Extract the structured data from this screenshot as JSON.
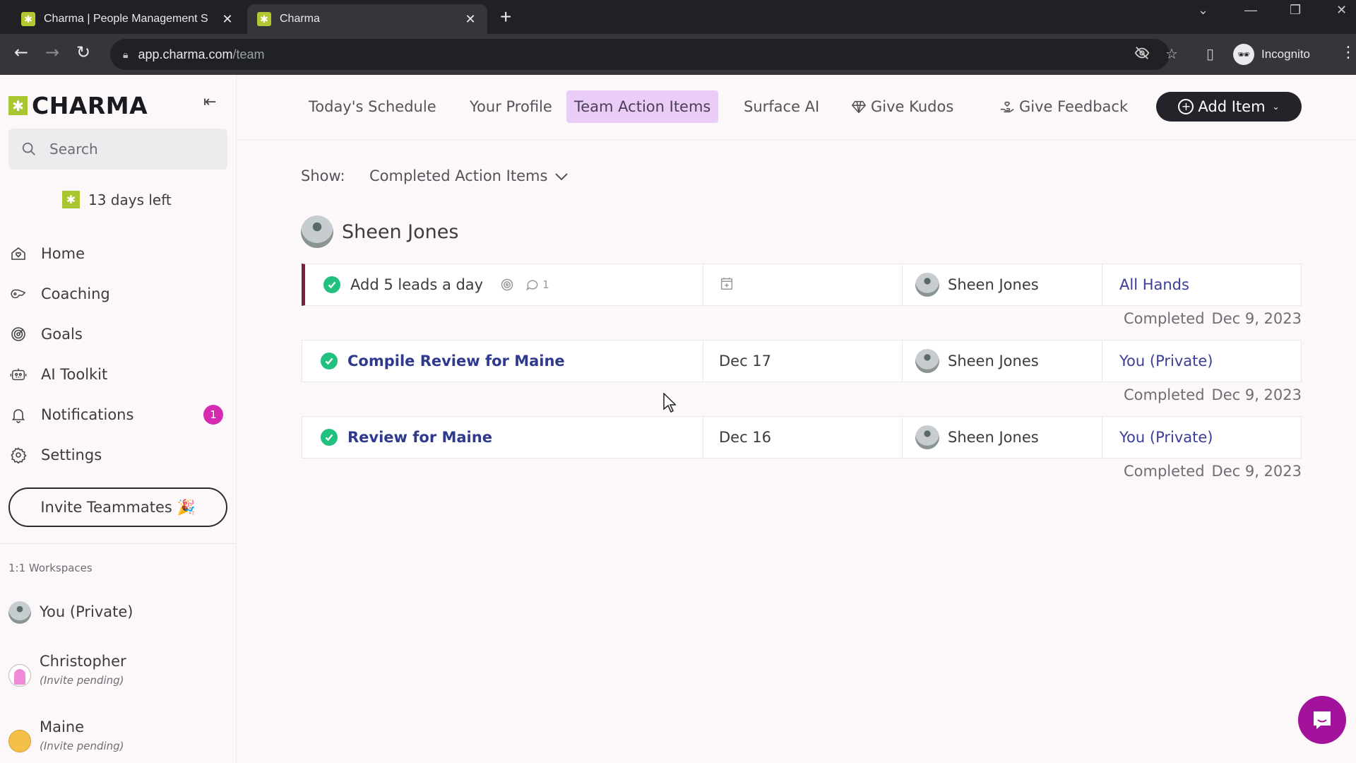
{
  "browser": {
    "tabs": [
      {
        "title": "Charma | People Management S",
        "active": false
      },
      {
        "title": "Charma",
        "active": true
      }
    ],
    "url_host": "app.charma.com",
    "url_path": "/team",
    "profile_label": "Incognito"
  },
  "sidebar": {
    "brand": "CHARMA",
    "search_placeholder": "Search",
    "trial_text": "13 days left",
    "nav": [
      {
        "label": "Home",
        "icon": "home-heart-icon"
      },
      {
        "label": "Coaching",
        "icon": "whistle-icon"
      },
      {
        "label": "Goals",
        "icon": "target-icon"
      },
      {
        "label": "AI Toolkit",
        "icon": "robot-icon"
      },
      {
        "label": "Notifications",
        "icon": "bell-icon",
        "badge": "1"
      },
      {
        "label": "Settings",
        "icon": "gear-icon"
      }
    ],
    "invite_label": "Invite Teammates 🎉",
    "workspaces_title": "1:1 Workspaces",
    "workspaces": [
      {
        "name": "You (Private)",
        "status": ""
      },
      {
        "name": "Christopher",
        "status": "(Invite pending)"
      },
      {
        "name": "Maine",
        "status": "(Invite pending)"
      }
    ]
  },
  "topnav": {
    "items": [
      {
        "label": "Today's Schedule",
        "active": false
      },
      {
        "label": "Your Profile",
        "active": false
      },
      {
        "label": "Team Action Items",
        "active": true
      },
      {
        "label": "Surface AI",
        "active": false
      },
      {
        "label": "Give Kudos",
        "active": false
      },
      {
        "label": "Give Feedback",
        "active": false
      }
    ],
    "add_item_label": "Add Item"
  },
  "main": {
    "show_label": "Show:",
    "show_value": "Completed Action Items",
    "owner_name": "Sheen Jones",
    "items": [
      {
        "title": "Add 5 leads a day",
        "linked": false,
        "has_goal": true,
        "comments": "1",
        "due": "",
        "assignee": "Sheen Jones",
        "workspace": "All Hands",
        "completed_label": "Completed",
        "completed_date": "Dec 9, 2023"
      },
      {
        "title": "Compile Review for Maine",
        "linked": true,
        "has_goal": false,
        "comments": "",
        "due": "Dec 17",
        "assignee": "Sheen Jones",
        "workspace": "You (Private)",
        "completed_label": "Completed",
        "completed_date": "Dec 9, 2023"
      },
      {
        "title": "Review for Maine",
        "linked": true,
        "has_goal": false,
        "comments": "",
        "due": "Dec 16",
        "assignee": "Sheen Jones",
        "workspace": "You (Private)",
        "completed_label": "Completed",
        "completed_date": "Dec 9, 2023"
      }
    ]
  },
  "colors": {
    "brand_green": "#a9c531",
    "active_tab_bg": "#e9cdf7",
    "check_green": "#22c07e",
    "link_blue": "#2f3a8f",
    "badge_magenta": "#d42bb0",
    "chat_fab": "#a3129b",
    "flag_maroon": "#7a1f3a"
  }
}
